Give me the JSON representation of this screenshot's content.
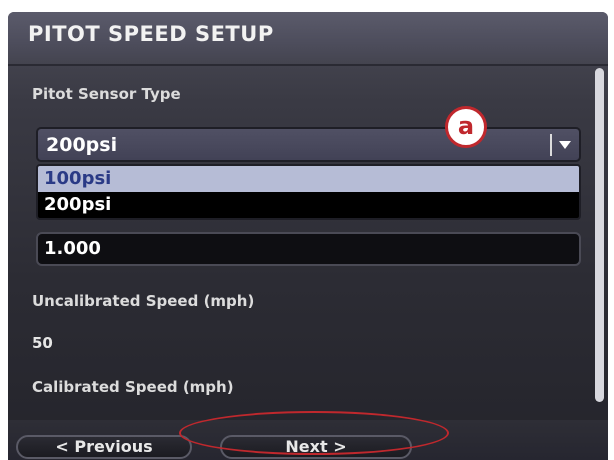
{
  "window": {
    "title": "PITOT SPEED SETUP"
  },
  "form": {
    "sensor_type_label": "Pitot Sensor Type",
    "sensor_type_selected": "200psi",
    "sensor_type_options": [
      "100psi",
      "200psi"
    ],
    "multiplier_value": "1.000",
    "uncalibrated_label": "Uncalibrated Speed (mph)",
    "uncalibrated_value": "50",
    "calibrated_label": "Calibrated Speed (mph)"
  },
  "annotation": {
    "callout_letter": "a",
    "callout_color": "#c0282d"
  },
  "nav": {
    "previous_label": "< Previous",
    "next_label": "Next >"
  },
  "icons": {
    "dropdown": "chevron-down-icon",
    "scrollbar": "scrollbar"
  },
  "colors": {
    "title_bar": "#4d4d5c",
    "selected_option_bg": "#000000",
    "hover_option_bg": "#b6bcd6"
  }
}
